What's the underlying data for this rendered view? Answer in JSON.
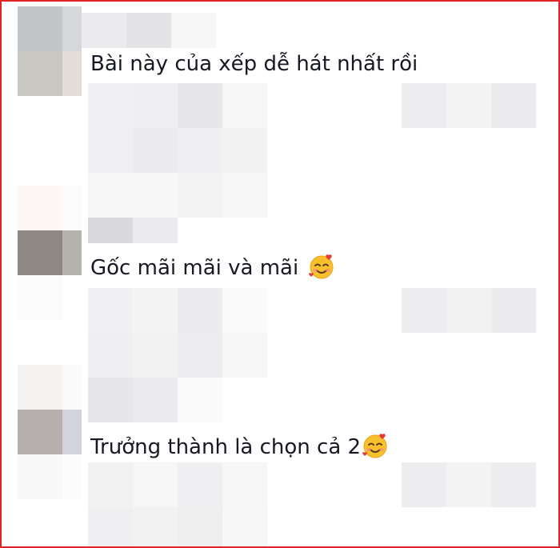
{
  "comments": [
    {
      "text": "Bài này của xếp dễ hát nhất rồi",
      "emoji": ""
    },
    {
      "text": "Gốc mãi mãi và mãi ",
      "emoji": "smiling-face-with-hearts-icon"
    },
    {
      "text": "Trưởng thành là chọn cả 2",
      "emoji": "smiling-face-with-hearts-icon"
    }
  ],
  "colors": {
    "border": "#e02424",
    "text": "#161823",
    "blur_light": "#f1f1f2",
    "blur_mid": "#e8e8ea"
  }
}
